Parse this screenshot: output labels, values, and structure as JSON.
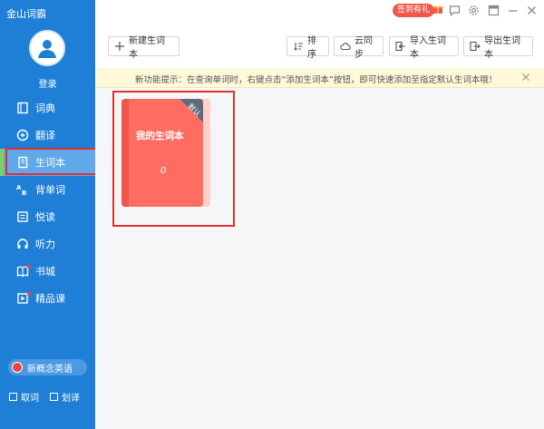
{
  "app": {
    "title": "金山词霸",
    "login": "登录"
  },
  "nav": [
    {
      "label": "词典",
      "icon": "dictionary-icon"
    },
    {
      "label": "翻译",
      "icon": "translate-icon"
    },
    {
      "label": "生词本",
      "icon": "wordbook-icon",
      "active": true
    },
    {
      "label": "背单词",
      "icon": "memorize-icon"
    },
    {
      "label": "悦读",
      "icon": "reading-icon"
    },
    {
      "label": "听力",
      "icon": "headphones-icon"
    },
    {
      "label": "书城",
      "icon": "bookstore-icon"
    },
    {
      "label": "精品课",
      "icon": "course-icon"
    }
  ],
  "sidebar_footer": {
    "ncb_label": "新概念英语",
    "checkbox_1": "取词",
    "checkbox_2": "划译"
  },
  "topbar": {
    "signin_label": "签到有礼"
  },
  "toolbar": {
    "new_label": "新建生词本",
    "sort_label": "排序",
    "sync_label": "云同步",
    "import_label": "导入生词本",
    "export_label": "导出生词本"
  },
  "notice": {
    "text": "新功能提示：在查询单词时，右键点击“添加生词本”按钮，即可快速添加至指定默认生词本哦！"
  },
  "book": {
    "title": "我的生词本",
    "count": "0",
    "ribbon": "默认"
  },
  "colors": {
    "sidebar": "#1f7fd6",
    "active": "#5fa8ea",
    "book": "#ff6d62",
    "highlight": "#e0312d"
  }
}
